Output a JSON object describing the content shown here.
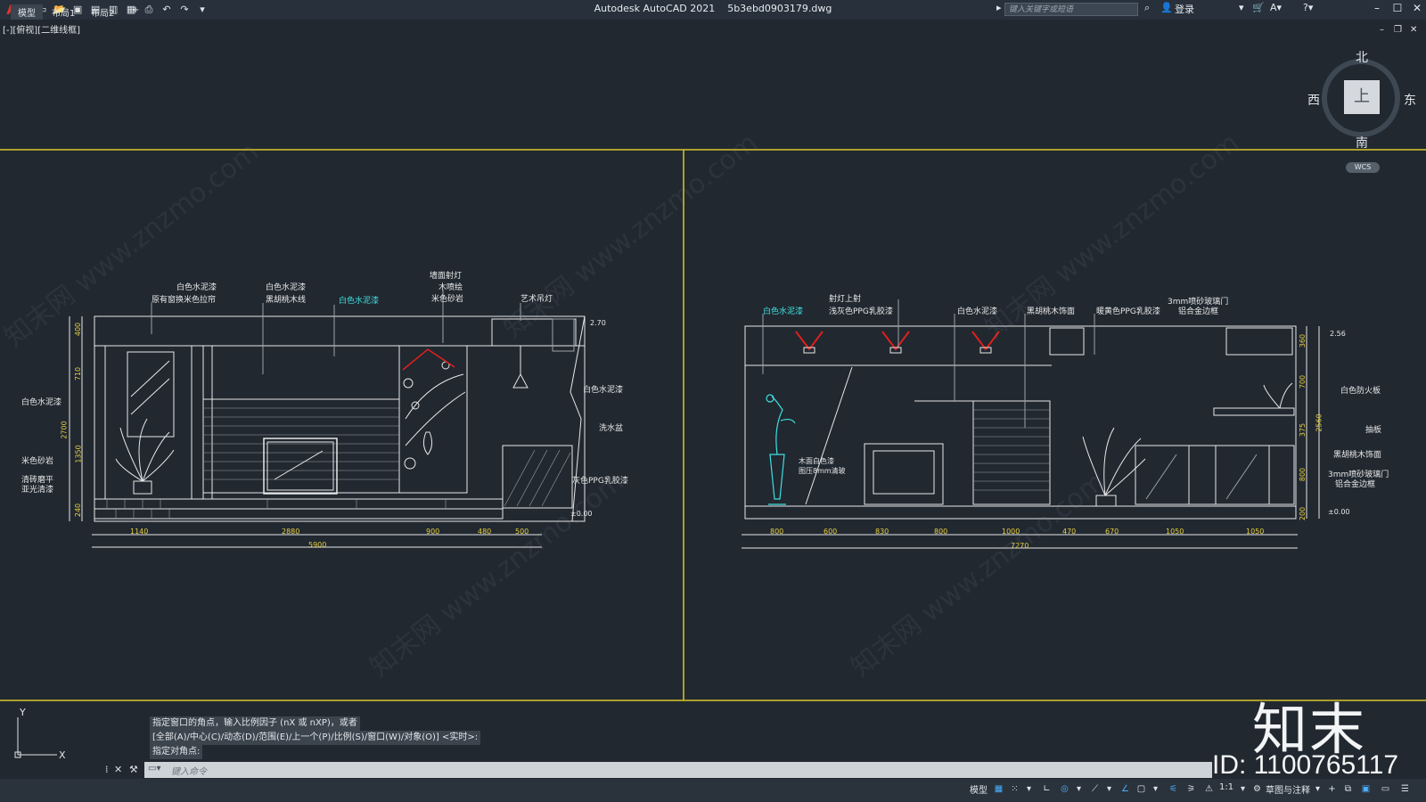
{
  "app": {
    "name": "Autodesk AutoCAD 2021",
    "file": "5b3ebd0903179.dwg"
  },
  "search": {
    "placeholder": "键入关键字或短语"
  },
  "user": {
    "login": "登录"
  },
  "viewport": {
    "label": "[-][俯视][二维线框]"
  },
  "viewcube": {
    "face": "上",
    "north": "北",
    "south": "南",
    "west": "西",
    "east": "东",
    "wcs": "WCS"
  },
  "left_elevation": {
    "callouts_top": [
      "白色水泥漆",
      "原有窗换米色拉帘",
      "白色水泥漆",
      "黑胡桃木线",
      "白色水泥漆",
      "墙面射灯",
      "木喷绘",
      "米色砂岩",
      "艺术吊灯"
    ],
    "callouts_left": [
      "白色水泥漆",
      "米色砂岩",
      "清砖磨平",
      "亚光清漆"
    ],
    "callouts_right": [
      "白色水泥漆",
      "洗水盆",
      "灰色PPG乳胶漆"
    ],
    "level_top": "2.70",
    "level_bottom": "±0.00",
    "vdims": [
      "400",
      "710",
      "1350",
      "240",
      "2700"
    ],
    "hdims": [
      "1140",
      "2880",
      "900",
      "480",
      "500"
    ],
    "total": "5900"
  },
  "right_elevation": {
    "callouts_top": [
      "白色水泥漆",
      "射灯上射",
      "浅灰色PPG乳胶漆",
      "白色水泥漆",
      "黑胡桃木饰面",
      "暖黄色PPG乳胶漆",
      "3mm喷砂玻璃门",
      "铝合金边框"
    ],
    "callouts_right": [
      "白色防火板",
      "抽板",
      "黑胡桃木饰面",
      "3mm喷砂玻璃门",
      "铝合金边框"
    ],
    "note": [
      "木面白色漆",
      "图压8mm清玻"
    ],
    "level_top": "2.56",
    "level_bottom": "±0.00",
    "vdims": [
      "360",
      "700",
      "375",
      "800",
      "200",
      "2560"
    ],
    "hdims": [
      "800",
      "600",
      "830",
      "800",
      "1000",
      "470",
      "670",
      "1050",
      "1050"
    ],
    "total": "7270"
  },
  "watermark": "知末网 www.znzmo.com",
  "command": {
    "history": [
      "指定窗口的角点，输入比例因子 (nX 或 nXP)，或者",
      "[全部(A)/中心(C)/动态(D)/范围(E)/上一个(P)/比例(S)/窗口(W)/对象(O)] <实时>:",
      "指定对角点:"
    ],
    "placeholder": "键入命令"
  },
  "tabs": [
    "模型",
    "布局1",
    "布局2"
  ],
  "status": {
    "model": "模型",
    "scale": "1:1",
    "workspace": "草图与注释"
  },
  "brand": {
    "logo": "知末",
    "id": "ID: 1100765117"
  },
  "colors": {
    "background": "#212830",
    "viewport_border": "#d7c52a",
    "lines": "#e8e8e8",
    "cyan": "#3fe0e0",
    "red_fixture": "#e0201c"
  }
}
